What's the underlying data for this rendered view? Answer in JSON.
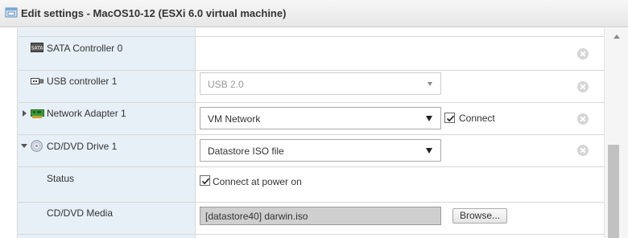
{
  "window": {
    "title": "Edit settings - MacOS10-12 (ESXi 6.0 virtual machine)"
  },
  "rows": [
    {
      "label": "SATA Controller 0",
      "icon": "sata-controller-icon"
    },
    {
      "label": "USB controller 1",
      "icon": "usb-icon",
      "select_value": "USB 2.0",
      "select_disabled": true
    },
    {
      "label": "Network Adapter 1",
      "icon": "network-adapter-icon",
      "expander": "collapsed",
      "select_value": "VM Network",
      "checkbox_label": "Connect",
      "checkbox_checked": true
    },
    {
      "label": "CD/DVD Drive 1",
      "icon": "cd-dvd-icon",
      "expander": "expanded",
      "select_value": "Datastore ISO file"
    },
    {
      "label": "Status",
      "checkbox_label": "Connect at power on",
      "checkbox_checked": true
    },
    {
      "label": "CD/DVD Media",
      "media_value": "[datastore40] darwin.iso",
      "browse_label": "Browse..."
    }
  ],
  "colors": {
    "label_column_bg": "#e7f0f7",
    "media_field_bg": "#cfcfcf"
  }
}
